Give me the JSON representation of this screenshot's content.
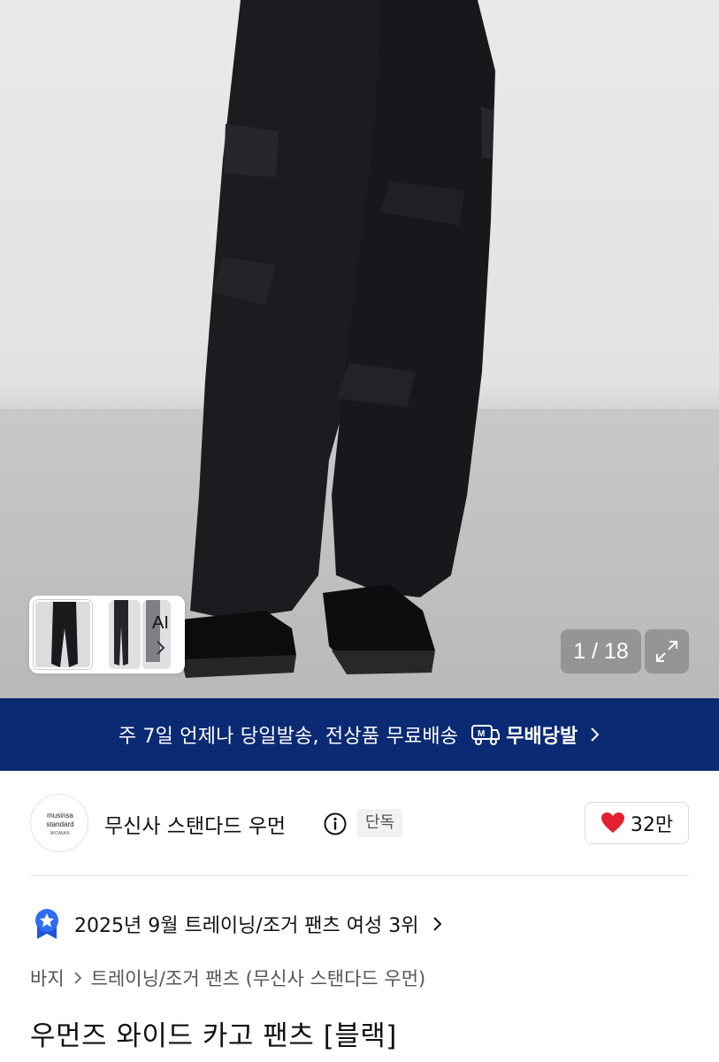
{
  "gallery": {
    "counter": "1 / 18",
    "ai_label": "AI",
    "expand_icon": "expand-icon",
    "thumb_icon": "chevron-right-icon"
  },
  "banner": {
    "text": "주 7일 언제나 당일발송, 전상품 무료배송",
    "badge_label": "무배당발",
    "badge_icon": "delivery-truck-icon",
    "bg_color": "#0a2a73"
  },
  "brand": {
    "logo_line1": "musinsa",
    "logo_line2": "standard",
    "logo_line3": "WOMAN",
    "name": "무신사 스탠다드 우먼",
    "tag": "단독",
    "like_count": "32만",
    "heart_color": "#e3202f"
  },
  "ranking": {
    "text": "2025년 9월 트레이닝/조거 팬츠 여성 3위",
    "badge_color": "#2f6df2"
  },
  "breadcrumb": {
    "items": [
      "바지",
      "트레이닝/조거 팬츠 (무신사 스탠다드 우먼)"
    ]
  },
  "product": {
    "title": "우먼즈 와이드 카고 팬츠 [블랙]"
  }
}
